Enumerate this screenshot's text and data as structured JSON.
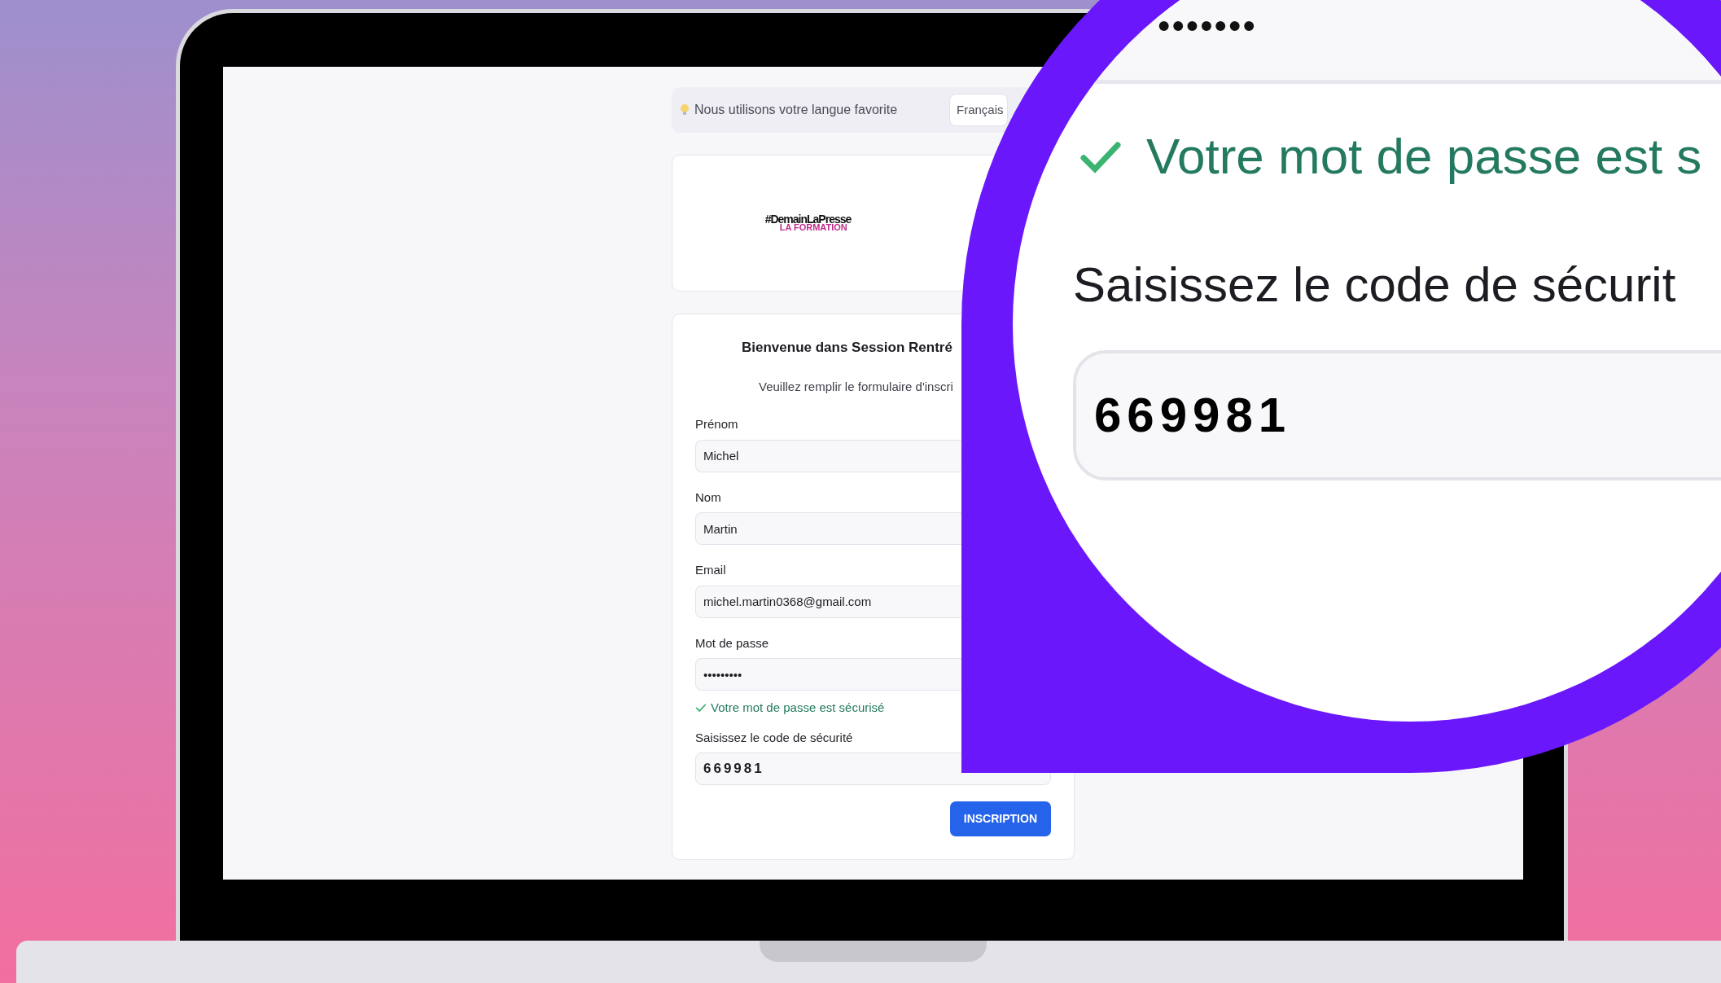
{
  "language_bar": {
    "message": "Nous utilisons votre langue favorite",
    "language": "Français"
  },
  "logo": {
    "line_1": "#DemainLaPresse",
    "line_2": "LA FORMATION"
  },
  "form": {
    "title": "Bienvenue dans Session Rentré",
    "subtitle": "Veuillez remplir le formulaire d'inscri",
    "fields": [
      {
        "label": "Prénom",
        "value": "Michel",
        "kind": "text"
      },
      {
        "label": "Nom",
        "value": "Martin",
        "kind": "text"
      },
      {
        "label": "Email",
        "value": "michel.martin0368@gmail.com",
        "kind": "text"
      },
      {
        "label": "Mot de passe",
        "value": "•••••••••",
        "kind": "password"
      },
      {
        "label": "Saisissez le code de sécurité",
        "value": "669981",
        "kind": "code"
      }
    ],
    "password_status": {
      "text": "Votre mot de passe est sécurisé",
      "valid": true
    },
    "submit": "INSCRIPTION"
  },
  "magnifier": {
    "password_dots": "•••••••",
    "status_text": "Votre mot de passe est s",
    "code_label": "Saisissez le code de sécurit",
    "code_value": "669981"
  }
}
